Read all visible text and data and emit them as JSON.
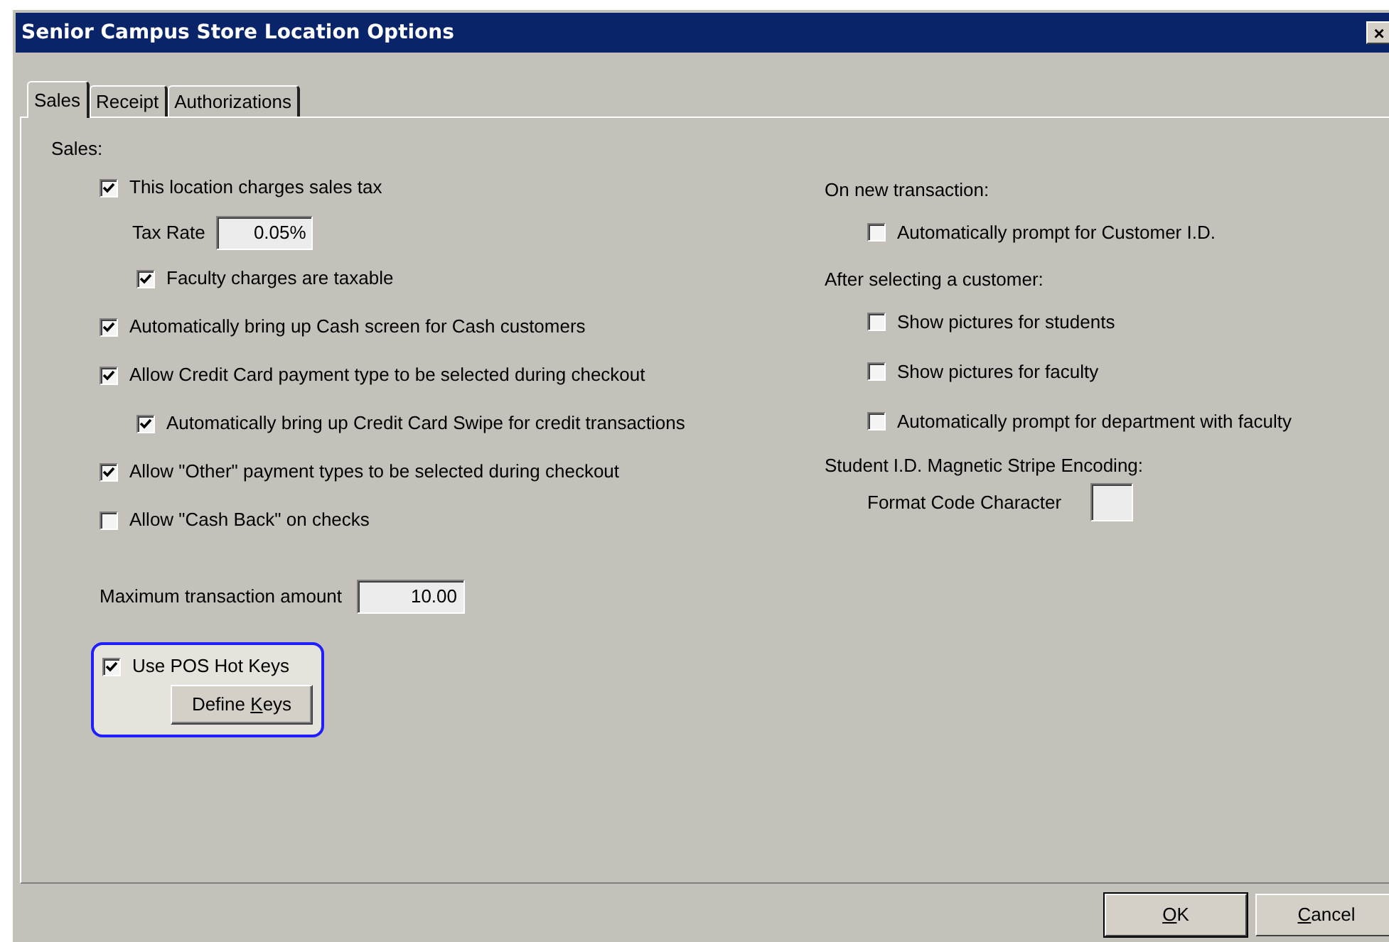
{
  "window": {
    "title": "Senior Campus Store Location Options",
    "close": "×"
  },
  "tabs": [
    {
      "label": "Sales",
      "selected": true
    },
    {
      "label": "Receipt",
      "selected": false
    },
    {
      "label": "Authorizations",
      "selected": false
    }
  ],
  "sales": {
    "heading": "Sales:",
    "items": [
      {
        "kind": "checkbox",
        "indent": false,
        "label": "This location charges sales tax",
        "checked": true
      },
      {
        "kind": "field",
        "label": "Tax Rate",
        "value": "0.05%"
      },
      {
        "kind": "checkbox",
        "indent": true,
        "label": "Faculty charges are taxable",
        "checked": true
      },
      {
        "kind": "checkbox",
        "indent": false,
        "label": "Automatically bring up Cash screen for Cash customers",
        "checked": true
      },
      {
        "kind": "checkbox",
        "indent": false,
        "label": "Allow Credit Card payment type to be selected during checkout",
        "checked": true
      },
      {
        "kind": "checkbox",
        "indent": true,
        "label": "Automatically bring up Credit Card Swipe for credit transactions",
        "checked": true
      },
      {
        "kind": "checkbox",
        "indent": false,
        "label": "Allow \"Other\" payment types to be selected during checkout",
        "checked": true
      },
      {
        "kind": "checkbox",
        "indent": false,
        "label": "Allow \"Cash Back\" on checks",
        "checked": false
      }
    ],
    "max_amount": {
      "label": "Maximum transaction amount",
      "value": "10.00"
    },
    "hot_keys": {
      "label": "Use POS Hot Keys",
      "checked": true,
      "highlighted": true,
      "button": {
        "before": "Define ",
        "key": "K",
        "after": "eys"
      }
    }
  },
  "customer": {
    "sections": [
      {
        "heading": "On new transaction:",
        "items": [
          {
            "label": "Automatically prompt for Customer I.D.",
            "checked": false
          }
        ]
      },
      {
        "heading": "After selecting a customer:",
        "items": [
          {
            "label": "Show pictures for students",
            "checked": false
          },
          {
            "label": "Show pictures for faculty",
            "checked": false
          },
          {
            "label": "Automatically prompt for department with faculty",
            "checked": false
          }
        ]
      }
    ],
    "encoding": {
      "heading": "Student I.D. Magnetic Stripe Encoding:",
      "label": "Format Code Character"
    }
  },
  "buttons": [
    {
      "key": "O",
      "after": "K",
      "default": true
    },
    {
      "key": "C",
      "after": "ancel",
      "default": false
    }
  ]
}
